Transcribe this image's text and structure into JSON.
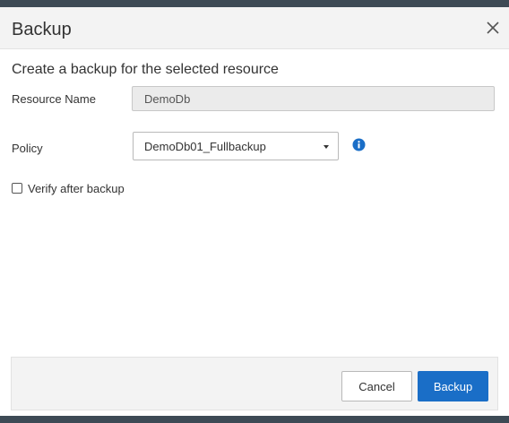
{
  "dialog": {
    "title": "Backup",
    "subtitle": "Create a backup for the selected resource"
  },
  "form": {
    "resource_name_label": "Resource Name",
    "resource_name_value": "DemoDb",
    "policy_label": "Policy",
    "policy_selected": "DemoDb01_Fullbackup",
    "verify_label": "Verify after backup",
    "verify_checked": false
  },
  "footer": {
    "cancel_label": "Cancel",
    "backup_label": "Backup"
  },
  "icons": {
    "close": "close-icon",
    "policy_info": "info-icon",
    "dropdown": "caret-down-icon"
  },
  "colors": {
    "primary": "#1a6ec7",
    "info": "#1a6ec7",
    "header_bg": "#f3f3f3"
  }
}
